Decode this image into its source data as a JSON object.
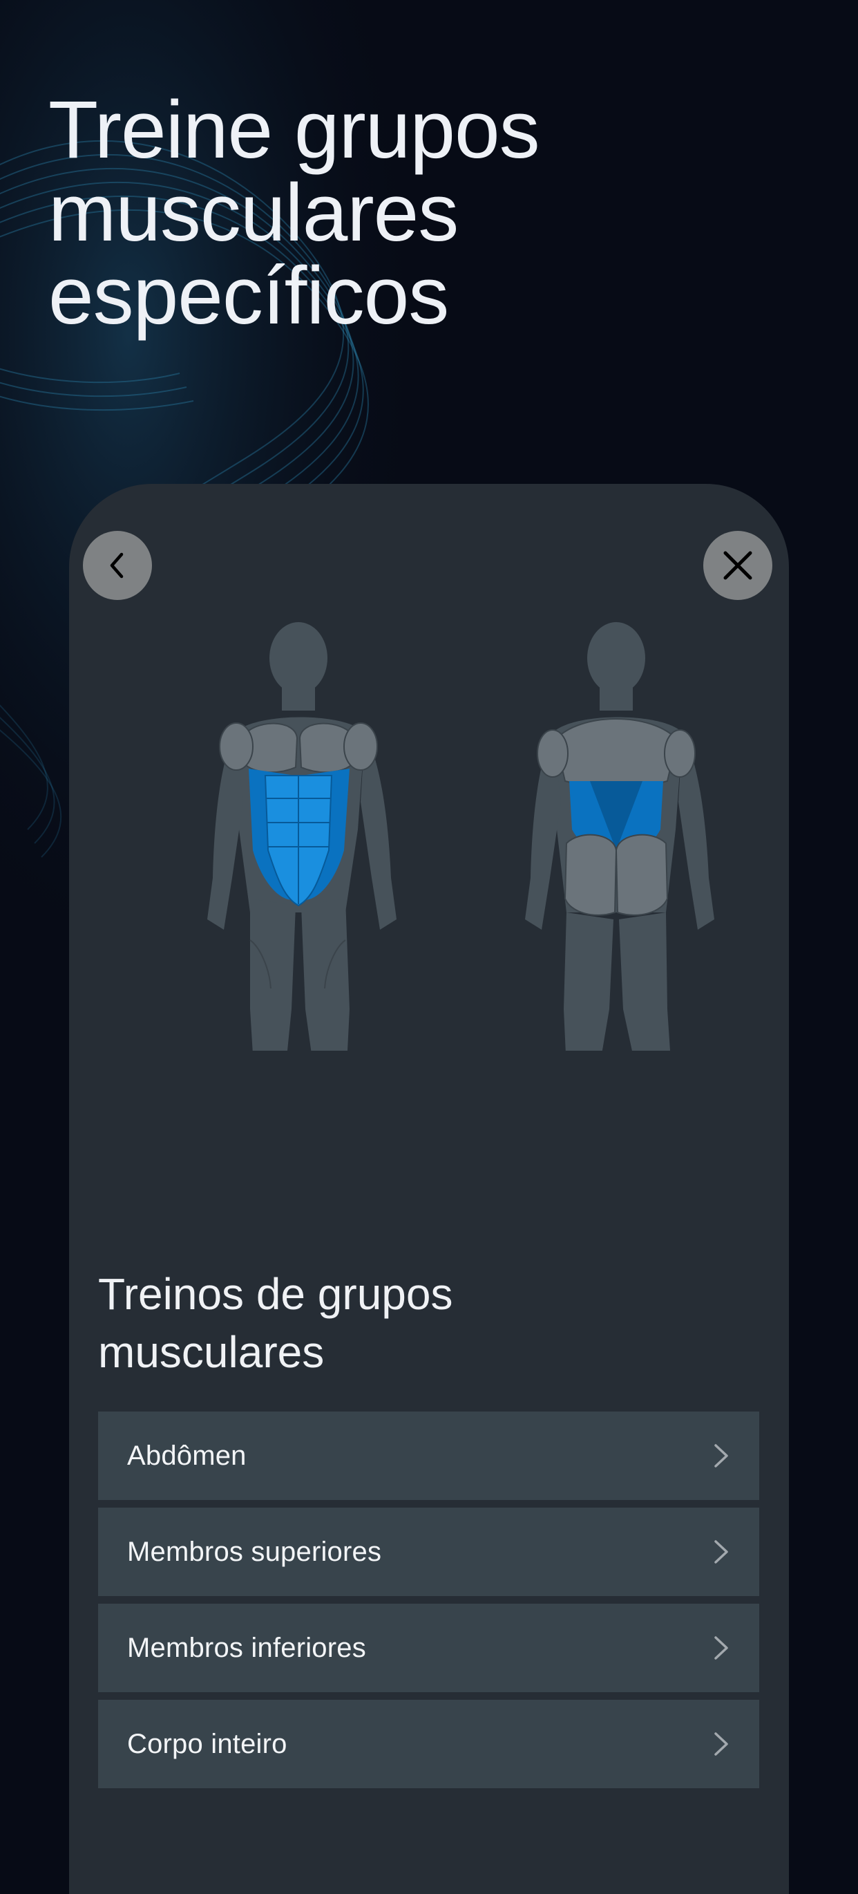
{
  "headline": "Treine grupos\nmusculares\nespecíficos",
  "card": {
    "back_icon": "chevron-left-icon",
    "close_icon": "close-icon",
    "section_title": "Treinos de grupos\nmusculares",
    "muscle_groups": [
      {
        "label": "Abdômen",
        "icon": "chevron-right-icon"
      },
      {
        "label": "Membros superiores",
        "icon": "chevron-right-icon"
      },
      {
        "label": "Membros inferiores",
        "icon": "chevron-right-icon"
      },
      {
        "label": "Corpo inteiro",
        "icon": "chevron-right-icon"
      }
    ],
    "highlighted_muscles": [
      "abdominals",
      "obliques",
      "lower-back"
    ]
  },
  "colors": {
    "background": "#070b16",
    "card": "#262d35",
    "list_item": "#38444c",
    "highlight": "#0a72c0",
    "highlight_light": "#1a8fdf",
    "body_dark": "#47525a",
    "body_light": "#6b747b"
  }
}
